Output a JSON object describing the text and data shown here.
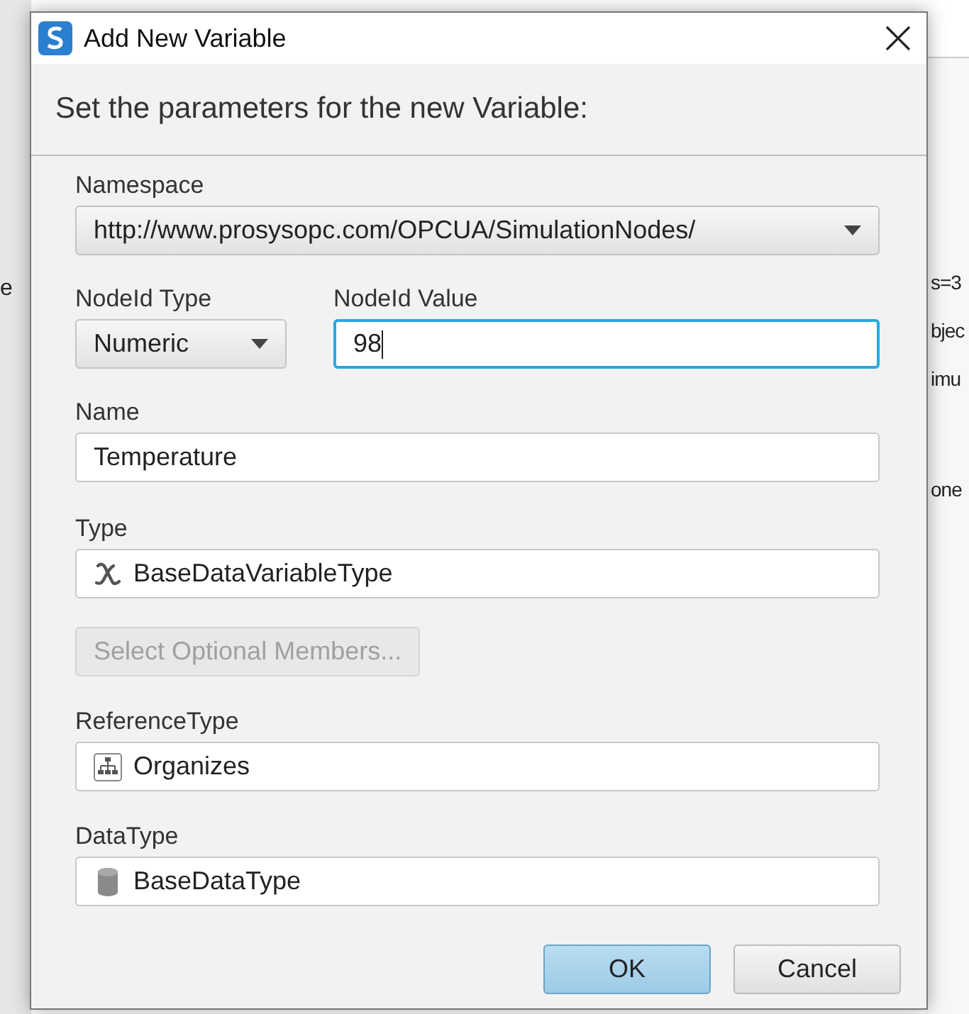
{
  "background": {
    "left_fragments": [
      "e"
    ],
    "right_fragments": [
      "s=3",
      "bjec",
      "imu",
      "one"
    ]
  },
  "window": {
    "title": "Add New Variable"
  },
  "header": "Set the parameters for the new Variable:",
  "namespace": {
    "label": "Namespace",
    "value": "http://www.prosysopc.com/OPCUA/SimulationNodes/"
  },
  "nodeid_type": {
    "label": "NodeId Type",
    "value": "Numeric"
  },
  "nodeid_value": {
    "label": "NodeId Value",
    "value": "98",
    "focused": true
  },
  "name": {
    "label": "Name",
    "value": "Temperature"
  },
  "type": {
    "label": "Type",
    "value": "BaseDataVariableType"
  },
  "optional_members_button": {
    "label": "Select Optional Members...",
    "disabled": true
  },
  "reference_type": {
    "label": "ReferenceType",
    "value": "Organizes"
  },
  "data_type": {
    "label": "DataType",
    "value": "BaseDataType"
  },
  "buttons": [
    {
      "label": "OK",
      "default": true
    },
    {
      "label": "Cancel",
      "default": false
    }
  ]
}
